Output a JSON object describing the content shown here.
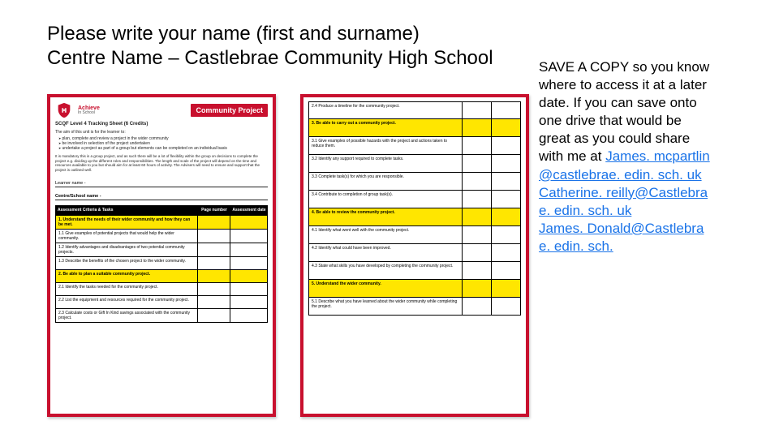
{
  "heading": {
    "line1": "Please write your name (first and surname)",
    "line2": "Centre Name – Castlebrae Community High School"
  },
  "side_note": {
    "lead_caps": "SAVE A COPY",
    "body1": " so you know where to access it at a later date. If you can save onto one drive that would be great as you could share with me at ",
    "emails": {
      "e1": "James. mcpartlin@castlebrae. edin. sch. uk",
      "e2": "Catherine. reilly@Castlebrae. edin. sch. uk",
      "e3": "James. Donald@Castlebrae. edin. sch."
    }
  },
  "page1": {
    "logo": {
      "l1": "Achieve",
      "l2": "In School"
    },
    "banner": "Community Project",
    "scqf": "SCQF Level 4 Tracking Sheet (6 Credits)",
    "aim_title": "The aim of this unit is for the learner to:",
    "aim_items": [
      "plan, complete and review a project in the wider community",
      "be involved in selection of the project undertaken",
      "undertake a project as part of a group but elements can be completed on an individual basis"
    ],
    "para": "It is mandatory this is a group project, and as such there will be a lot of flexibility within the group on decisions to complete the project e.g. dividing up the different roles and responsibilities. The length and scale of the project will depend on the time and resources available to you but should aim for at least 60 hours of activity. The Advisers will need to ensure and support that the project is outlined well.",
    "learner_label": "Learner name -",
    "centre_label": "Centre/School name -",
    "crit_header": {
      "c1": "Assessment Criteria & Tasks",
      "c2": "Page number",
      "c3": "Assessment date"
    },
    "rows": [
      {
        "section": true,
        "text": "1.   Understand the needs of their wider community and how they can be met."
      },
      {
        "section": false,
        "text": "1.1 Give examples of potential projects that would help the wider community."
      },
      {
        "section": false,
        "text": "1.2 Identify advantages and disadvantages of two potential community projects."
      },
      {
        "section": false,
        "text": "1.3 Describe the benefits of the chosen project to the wider community."
      },
      {
        "section": true,
        "text": "2.   Be able to plan a suitable community project."
      },
      {
        "section": false,
        "text": "2.1 Identify the tasks needed for the community project."
      },
      {
        "section": false,
        "text": "2.2 List the equipment and resources required for the community project."
      },
      {
        "section": false,
        "text": "2.3 Calculate costs or Gift In Kind savings associated with the community project."
      }
    ]
  },
  "page2": {
    "rows": [
      {
        "section": false,
        "text": "2.4 Produce a timeline for the community project."
      },
      {
        "section": true,
        "text": "3.   Be able to carry out a community project."
      },
      {
        "section": false,
        "text": "3.1 Give examples of possible hazards with the project and actions taken to reduce them."
      },
      {
        "section": false,
        "text": "3.2 Identify any support required to complete tasks."
      },
      {
        "section": false,
        "text": "3.3 Complete task(s) for which you are responsible."
      },
      {
        "section": false,
        "text": "3.4 Contribute to completion of group task(s)."
      },
      {
        "section": true,
        "text": "4.   Be able to review the community project."
      },
      {
        "section": false,
        "text": "4.1 Identify what went well with the community project."
      },
      {
        "section": false,
        "text": "4.2 Identify what could have been improved."
      },
      {
        "section": false,
        "text": "4.3 State what skills you have developed by completing the community project."
      },
      {
        "section": true,
        "text": "5.   Understand the wider community."
      },
      {
        "section": false,
        "text": "5.1 Describe what you have learned about the wider community while completing the project."
      }
    ]
  }
}
